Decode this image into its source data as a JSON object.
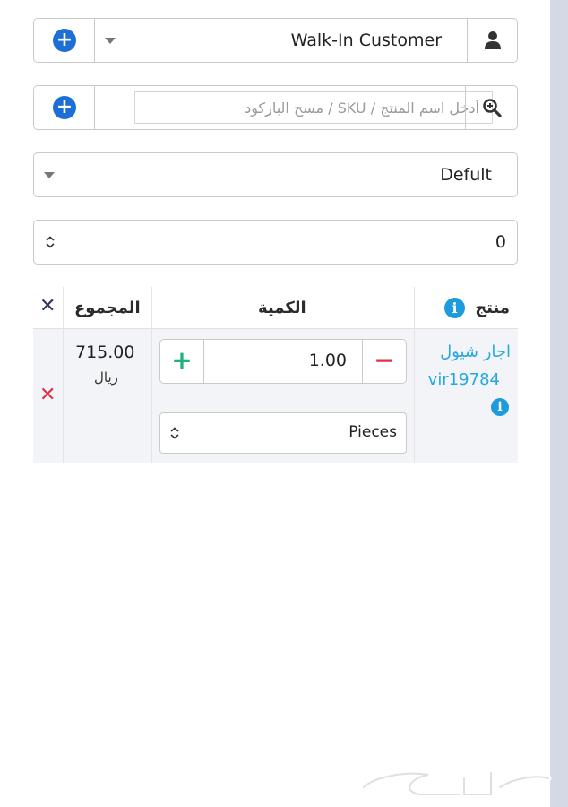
{
  "customer": {
    "value": "Walk-In Customer"
  },
  "product_search": {
    "placeholder": "أدخل اسم المنتج / SKU / مسح الباركود"
  },
  "price_group": {
    "value": "Defult"
  },
  "number_field": {
    "value": "0"
  },
  "table": {
    "headers": {
      "product": "منتج",
      "quantity": "الكمية",
      "total": "المجموع",
      "remove_all": "✕"
    },
    "rows": [
      {
        "product_name": "اجار شيول",
        "product_sku": "vir19784",
        "quantity": "1.00",
        "unit": "Pieces",
        "total": "715.00",
        "currency": "ريال",
        "remove": "✕"
      }
    ]
  },
  "watermark": {
    "text": "حراج"
  },
  "icons": {
    "customer": "user-icon",
    "search": "search-plus-icon",
    "add": "plus-circle-icon",
    "info": "info-circle-icon",
    "dropdown": "caret-down-icon",
    "select": "sort-updown-icon"
  },
  "colors": {
    "primary_blue": "#1d6fd6",
    "link_blue": "#26a7e0",
    "add_green": "#21b27a",
    "remove_red": "#e0314b",
    "sidebar": "#d5d9e6"
  }
}
